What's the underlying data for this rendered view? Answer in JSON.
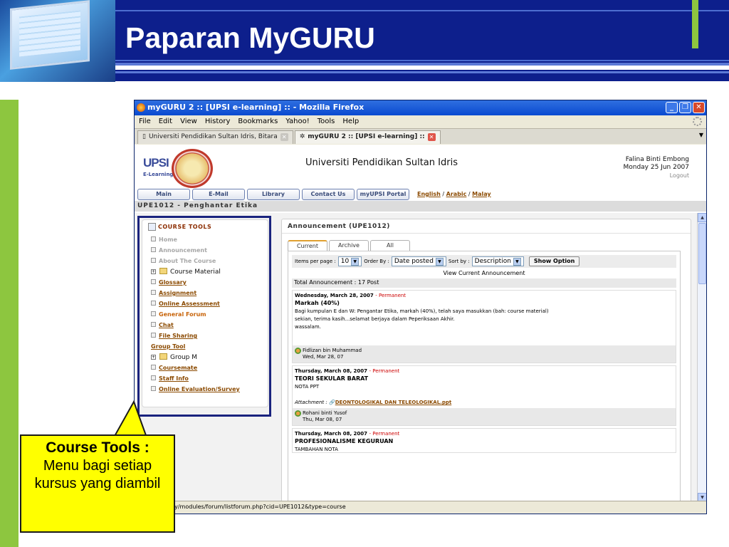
{
  "slide": {
    "title": "Paparan MyGURU",
    "callout_title": "Course Tools :",
    "callout_body": "Menu bagi setiap kursus yang diambil"
  },
  "browser": {
    "window_title": "myGURU 2 :: [UPSI e-learning] :: - Mozilla Firefox",
    "menu": [
      "File",
      "Edit",
      "View",
      "History",
      "Bookmarks",
      "Yahoo!",
      "Tools",
      "Help"
    ],
    "tabs": [
      {
        "label": "Universiti Pendidikan Sultan Idris, Bitara",
        "active": false
      },
      {
        "label": "myGURU 2 :: [UPSI e-learning] ::",
        "active": true
      }
    ],
    "status_url": "2.upsi.edu.my/modules/forum/listforum.php?cid=UPE1012&type=course"
  },
  "site": {
    "logo_text": "UPSI",
    "logo_sub": "E-Learning",
    "university": "Universiti Pendidikan Sultan Idris",
    "user_name": "Falina Binti Embong",
    "user_date": "Monday 25 Jun 2007",
    "logout": "Logout",
    "nav": [
      "Main",
      "E-Mail",
      "Library",
      "Contact Us",
      "myUPSI Portal"
    ],
    "languages": [
      "English",
      "Arabic",
      "Malay"
    ],
    "lang_sep": "/",
    "course": "UPE1012 - Penghantar Etika"
  },
  "course_tools": {
    "title": "COURSE TOOLS",
    "items": [
      {
        "label": "Home",
        "style": "grey"
      },
      {
        "label": "Announcement",
        "style": "grey"
      },
      {
        "label": "About The Course",
        "style": "grey"
      },
      {
        "label": "Course Material",
        "style": "folder"
      },
      {
        "label": "Glossary",
        "style": "link"
      },
      {
        "label": "Assignment",
        "style": "link"
      },
      {
        "label": "Online Assessment",
        "style": "link"
      },
      {
        "label": "General Forum",
        "style": "orange"
      },
      {
        "label": "Chat",
        "style": "link"
      },
      {
        "label": "File Sharing",
        "style": "link"
      },
      {
        "label": "Group Tool",
        "style": "group"
      },
      {
        "label": "Group M",
        "style": "folder"
      },
      {
        "label": "Coursemate",
        "style": "link"
      },
      {
        "label": "Staff Info",
        "style": "link"
      },
      {
        "label": "Online Evaluation/Survey",
        "style": "link"
      }
    ]
  },
  "announcement": {
    "title": "Announcement (UPE1012)",
    "tabs": [
      "Current",
      "Archive",
      "All"
    ],
    "items_per_page_label": "Items per page :",
    "items_per_page": "10",
    "order_by_label": "Order By :",
    "order_by": "Date posted",
    "sort_by_label": "Sort by :",
    "sort_by": "Description",
    "show_option": "Show Option",
    "view_current": "View Current Announcement",
    "total": "Total Announcement : 17 Post",
    "permanent": "- Permanent",
    "attachment_label": "Attachment :",
    "posts": [
      {
        "date": "Wednesday, March 28, 2007",
        "title": "Markah (40%)",
        "lines": [
          "Bagi kumpulan E dan W: Pengantar Etika, markah (40%), telah saya masukkan (bah: course material)",
          "sekian, terima kasih...selamat berjaya dalam Peperiksaan Akhir.",
          "wassalam."
        ],
        "attachment": "",
        "author": "Fidlizan bin Muhammad",
        "posted": "Wed, Mar 28, 07"
      },
      {
        "date": "Thursday, March 08, 2007",
        "title": "TEORI SEKULAR BARAT",
        "lines": [
          "NOTA PPT"
        ],
        "attachment": "DEONTOLOGIKAL DAN TELEOLOGIKAL.ppt",
        "author": "Rohani binti Yusof",
        "posted": "Thu, Mar 08, 07"
      },
      {
        "date": "Thursday, March 08, 2007",
        "title": "PROFESIONALISME KEGURUAN",
        "lines": [
          "TAMBAHAN NOTA"
        ],
        "attachment": "",
        "author": "",
        "posted": ""
      }
    ]
  }
}
